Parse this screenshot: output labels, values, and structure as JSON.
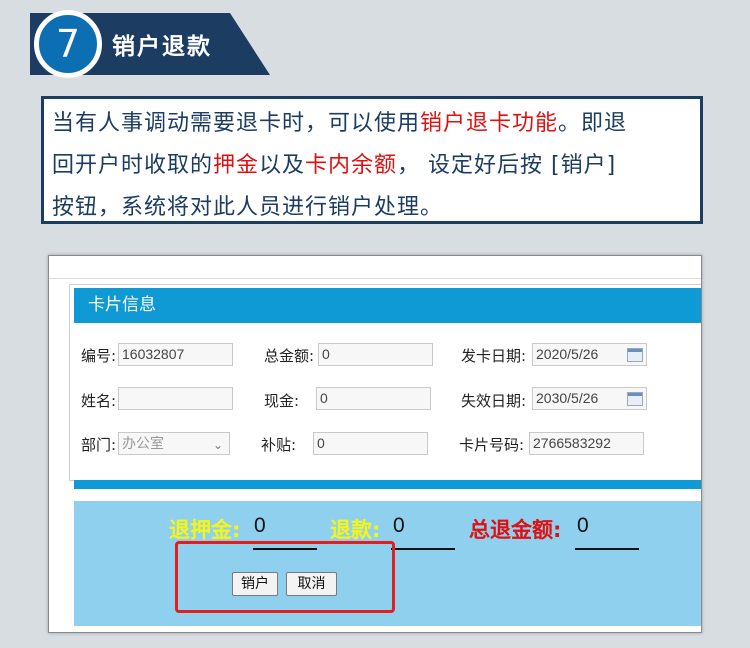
{
  "step": {
    "number": "7",
    "title": "销户退款"
  },
  "description": {
    "line1_a": "当有人事调动需要退卡时，可以使用",
    "line1_hl": "销户退卡功能",
    "line1_b": "。即退",
    "line2_a": "回开户时收取的",
    "line2_hl1": "押金",
    "line2_b": "以及",
    "line2_hl2": "卡内余额",
    "line2_c": "， 设定好后按 [销户]",
    "line3": "按钮，系统将对此人员进行销户处理。"
  },
  "card": {
    "header": "卡片信息",
    "fields": {
      "number_label": "编号:",
      "number_value": "16032807",
      "total_label": "总金额:",
      "total_value": "0",
      "issue_label": "发卡日期:",
      "issue_value": "2020/5/26",
      "name_label": "姓名:",
      "name_value": "",
      "cash_label": "现金:",
      "cash_value": "0",
      "expire_label": "失效日期:",
      "expire_value": "2030/5/26",
      "dept_label": "部门:",
      "dept_value": "办公室",
      "subsidy_label": "补贴:",
      "subsidy_value": "0",
      "cardno_label": "卡片号码:",
      "cardno_value": "2766583292"
    }
  },
  "refund": {
    "deposit_label": "退押金:",
    "deposit_value": "0",
    "refund_label": "退款:",
    "refund_value": "0",
    "total_label": "总退金额:",
    "total_value": "0"
  },
  "buttons": {
    "close_account": "销户",
    "cancel": "取消"
  },
  "colors": {
    "navy": "#1c3c62",
    "accent_blue": "#0f9ad6",
    "highlight_red": "#e01010",
    "label_yellow": "#f5f51a"
  }
}
